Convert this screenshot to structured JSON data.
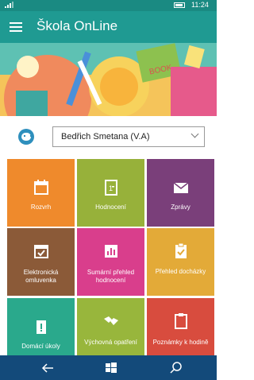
{
  "status": {
    "signal": "📶",
    "time": "11:24"
  },
  "header": {
    "title": "Škola OnLine"
  },
  "user": {
    "selected": "Bedřich Smetana (V.A)"
  },
  "banner": {
    "book_text": "BOOK"
  },
  "tiles": [
    {
      "label": "Rozvrh",
      "color": "#ef8a2c",
      "icon": "calendar-icon"
    },
    {
      "label": "Hodnocení",
      "color": "#97b13a",
      "icon": "grade-icon"
    },
    {
      "label": "Zprávy",
      "color": "#7a3f7a",
      "icon": "envelope-icon"
    },
    {
      "label": "Elektronická omluvenka",
      "color": "#8b5a38",
      "icon": "calendar-check-icon"
    },
    {
      "label": "Sumární přehled hodnocení",
      "color": "#d93e8c",
      "icon": "bar-chart-icon"
    },
    {
      "label": "Přehled docházky",
      "color": "#e3aa38",
      "icon": "clipboard-check-icon"
    },
    {
      "label": "Domácí úkoly",
      "color": "#2aa98c",
      "icon": "homework-icon"
    },
    {
      "label": "Výchovná opatření",
      "color": "#98b63c",
      "icon": "handshake-icon"
    },
    {
      "label": "Poznámky k hodině",
      "color": "#d84c3e",
      "icon": "clipboard-icon"
    }
  ],
  "colors": {
    "statusbar": "#1a8a82",
    "titlebar": "#1f9a92",
    "navbar": "#134a7a"
  }
}
